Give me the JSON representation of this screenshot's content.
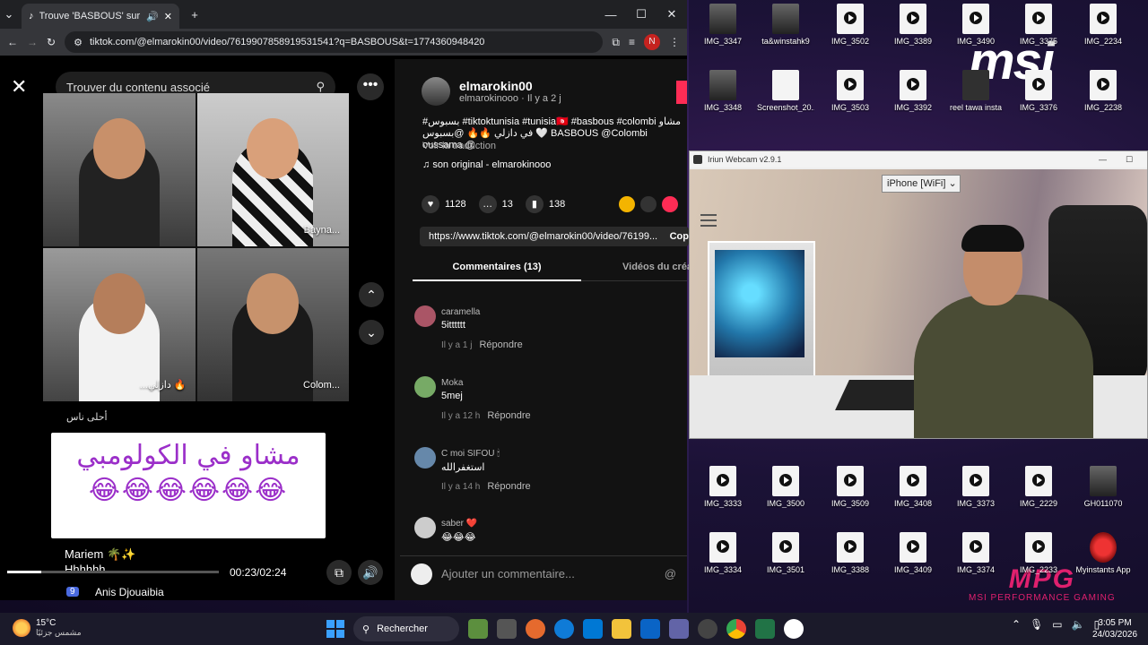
{
  "browser": {
    "tab_title": "Trouve 'BASBOUS' sur TikTok",
    "url": "tiktok.com/@elmarokin00/video/7619907858919531541?q=BASBOUS&t=1774360948420",
    "profile_initial": "N"
  },
  "video": {
    "search_placeholder": "Trouver du contenu associé",
    "cells": [
      {
        "label": ""
      },
      {
        "label": "Bayna..."
      },
      {
        "label": "...دازلي 🔥"
      },
      {
        "label": "Colom..."
      }
    ],
    "stream_comment_1": "أحلى ناس",
    "sticker_text": "مشاو في الكولومبي",
    "sticker_emojis": "😂😂😂😂😂😂",
    "live_user_1": "Mariem 🌴✨",
    "live_text_1": "Hhhhhh",
    "live_badge": "9",
    "live_user_2": "Anis Djouaibia",
    "time": "00:23/02:24",
    "progress": 0.16
  },
  "post": {
    "author": "elmarokin00",
    "author_sub": "elmarokinooo · Il y a 2 j",
    "description": "#بسبوس #tiktoktunisia #tunisia🇹🇳 #basbous #colombi مشاو في دازلي 🔥🔥 @بسبوس 🤍 BASBOUS @Colombi oussama @",
    "translate": "Voir la traduction",
    "sound": "son original - elmarokinooo",
    "likes": "1128",
    "comments_count": "13",
    "saves": "138",
    "link": "https://www.tiktok.com/@elmarokin00/video/76199...",
    "copy_label": "Cop",
    "tab_comments": "Commentaires (13)",
    "tab_creator": "Vidéos du créa",
    "add_comment_placeholder": "Ajouter un commentaire..."
  },
  "comments": [
    {
      "user": "caramella",
      "text": "5itttttt",
      "time": "Il y a 1 j",
      "reply": "Répondre"
    },
    {
      "user": "Moka",
      "text": "5mej",
      "time": "Il y a 12 h",
      "reply": "Répondre"
    },
    {
      "user": "C moi SIFOU 🕯",
      "text": "استغفرالله",
      "time": "Il y a 14 h",
      "reply": "Répondre"
    },
    {
      "user": "saber ❤️",
      "text": "😂😂😂",
      "time": "",
      "reply": ""
    }
  ],
  "iriun": {
    "title": "Iriun Webcam v2.9.1",
    "device": "iPhone [WiFi]"
  },
  "desktop_icons": [
    {
      "label": "IMG_3347"
    },
    {
      "label": "ta&winstahk9"
    },
    {
      "label": "IMG_3502"
    },
    {
      "label": "IMG_3389"
    },
    {
      "label": "IMG_3490"
    },
    {
      "label": "IMG_3375"
    },
    {
      "label": "IMG_2234"
    },
    {
      "label": "IMG_3348"
    },
    {
      "label": "Screenshot_20..."
    },
    {
      "label": "IMG_3503"
    },
    {
      "label": "IMG_3392"
    },
    {
      "label": "reel tawa insta"
    },
    {
      "label": "IMG_3376"
    },
    {
      "label": "IMG_2238"
    },
    {
      "label": "IMG_3333"
    },
    {
      "label": "IMG_3500"
    },
    {
      "label": "IMG_3509"
    },
    {
      "label": "IMG_3408"
    },
    {
      "label": "IMG_3373"
    },
    {
      "label": "IMG_2229"
    },
    {
      "label": "GH011070"
    },
    {
      "label": "IMG_3334"
    },
    {
      "label": "IMG_3501"
    },
    {
      "label": "IMG_3388"
    },
    {
      "label": "IMG_3409"
    },
    {
      "label": "IMG_3374"
    },
    {
      "label": "IMG_2233"
    },
    {
      "label": "Myinstants App"
    }
  ],
  "brand": {
    "logo": "msi",
    "mpg": "MPG",
    "mpg_sub": "MSI PERFORMANCE GAMING"
  },
  "taskbar": {
    "temp": "15°C",
    "weather": "مشمس جزئيًا",
    "search": "Rechercher",
    "time": "3:05 PM",
    "date": "24/03/2026"
  }
}
